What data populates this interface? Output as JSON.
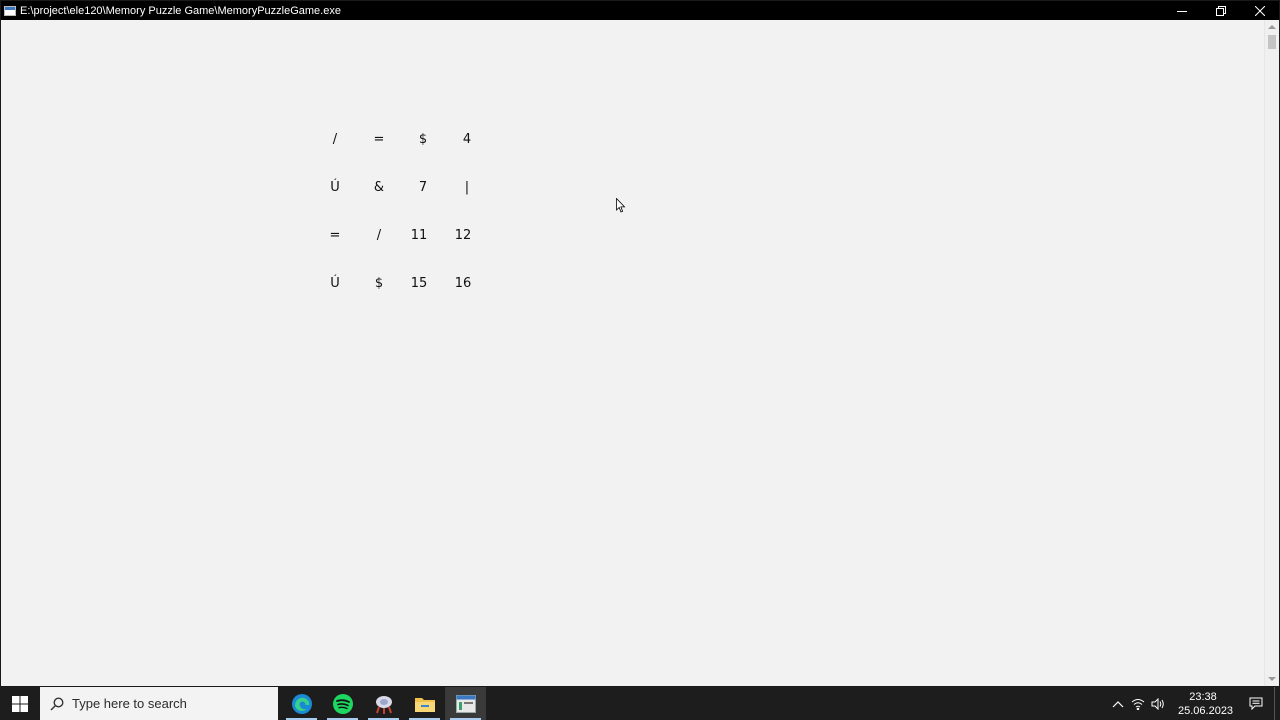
{
  "window": {
    "title": "E:\\project\\ele120\\Memory Puzzle Game\\MemoryPuzzleGame.exe",
    "app_icon": "console-window-icon",
    "controls": [
      "minimize-icon",
      "restore-icon",
      "close-icon"
    ]
  },
  "grid": {
    "rows": [
      [
        "/",
        "=",
        "$",
        "4"
      ],
      [
        "Ú",
        "&",
        "7",
        "|"
      ],
      [
        "=",
        "/",
        "11",
        "12"
      ],
      [
        "Ú",
        "$",
        "15",
        "16"
      ]
    ]
  },
  "taskbar": {
    "search_placeholder": "Type here to search",
    "apps": [
      {
        "name": "edge-icon",
        "running": true
      },
      {
        "name": "spotify-icon",
        "running": true
      },
      {
        "name": "app-icon",
        "running": true
      },
      {
        "name": "file-explorer-icon",
        "running": true
      },
      {
        "name": "console-app-icon",
        "running": true,
        "active": true
      }
    ],
    "clock": {
      "time": "23:38",
      "date": "25.06.2023"
    },
    "colors": {
      "background": "#1d1d1d",
      "accent": "#a8cdf0"
    }
  }
}
